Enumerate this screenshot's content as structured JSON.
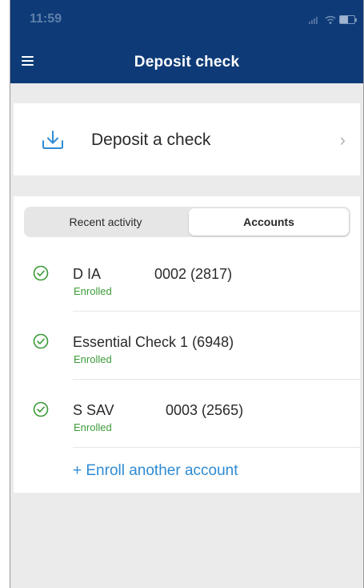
{
  "status_bar": {
    "time": "11:59",
    "icons": [
      "signal-icon",
      "wifi-icon",
      "battery-icon"
    ]
  },
  "nav": {
    "title": "Deposit check",
    "menu_icon": "hamburger-menu-icon"
  },
  "deposit_card": {
    "label": "Deposit a check",
    "icon": "download-icon",
    "chevron": "›"
  },
  "tabs": [
    {
      "label": "Recent activity",
      "selected": false
    },
    {
      "label": "Accounts",
      "selected": true
    }
  ],
  "accounts": [
    {
      "name": "D IA",
      "number": "0002 (2817)",
      "status": "Enrolled"
    },
    {
      "name": "Essential Check 1 (6948)",
      "number": "",
      "status": "Enrolled"
    },
    {
      "name": "S SAV",
      "number": "0003 (2565)",
      "status": "Enrolled"
    }
  ],
  "enroll_link": "+ Enroll another account",
  "colors": {
    "header": "#0e3b78",
    "accent_blue": "#2f8bd3",
    "enrolled_green": "#3b9a37",
    "background": "#ebebeb"
  }
}
